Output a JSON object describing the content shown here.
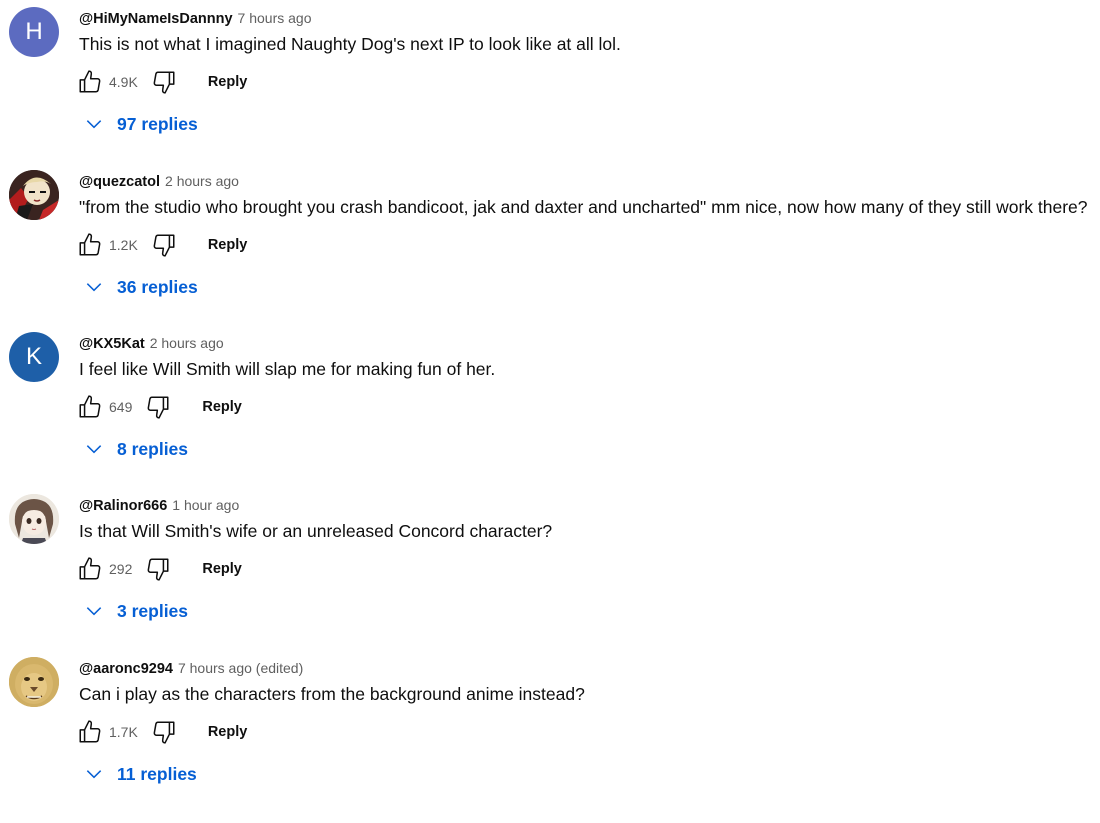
{
  "comments": [
    {
      "avatar_letter": "H",
      "avatar_color": "#5c6bc0",
      "author": "@HiMyNameIsDannny",
      "time": "7 hours ago",
      "text": "This is not what I imagined Naughty Dog's next IP to look like at all lol.",
      "likes": "4.9K",
      "reply_label": "Reply",
      "replies_label": "97 replies"
    },
    {
      "avatar_letter": "",
      "avatar_icon": "anime-character-avatar",
      "author": "@quezcatol",
      "time": "2 hours ago",
      "text": "\"from the studio who brought you crash bandicoot, jak and daxter and uncharted\" mm nice, now how many of they still work there?",
      "likes": "1.2K",
      "reply_label": "Reply",
      "replies_label": "36 replies"
    },
    {
      "avatar_letter": "K",
      "avatar_color": "#1e5fa8",
      "author": "@KX5Kat",
      "time": "2 hours ago",
      "text": "I feel like Will Smith will slap me for making fun of her.",
      "likes": "649",
      "reply_label": "Reply",
      "replies_label": "8 replies"
    },
    {
      "avatar_letter": "",
      "avatar_icon": "anime-girl-avatar",
      "author": "@Ralinor666",
      "time": "1 hour ago",
      "text": "Is that Will Smith's wife or an unreleased Concord character?",
      "likes": "292",
      "reply_label": "Reply",
      "replies_label": "3 replies"
    },
    {
      "avatar_letter": "",
      "avatar_icon": "lion-face-avatar",
      "author": "@aaronc9294",
      "time": "7 hours ago (edited)",
      "text": "Can i play as the characters from the background anime instead?",
      "likes": "1.7K",
      "reply_label": "Reply",
      "replies_label": "11 replies"
    }
  ],
  "colors": {
    "link": "#065fd4",
    "meta": "#606060",
    "text": "#0f0f0f"
  }
}
